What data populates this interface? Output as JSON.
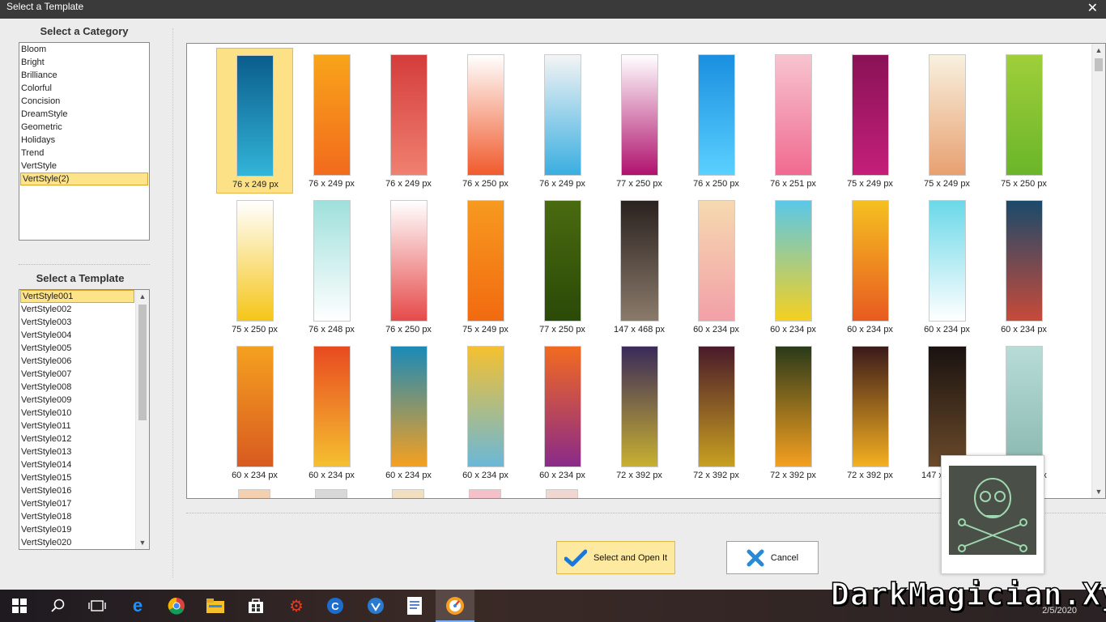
{
  "window": {
    "title": "Select a Template",
    "close_glyph": "✕"
  },
  "category_panel": {
    "heading": "Select a Category",
    "items": [
      "Bloom",
      "Bright",
      "Brilliance",
      "Colorful",
      "Concision",
      "DreamStyle",
      "Geometric",
      "Holidays",
      "Trend",
      "VertStyle",
      "VertStyle(2)"
    ],
    "selected": "VertStyle(2)"
  },
  "template_panel": {
    "heading": "Select a Template",
    "items": [
      "VertStyle001",
      "VertStyle002",
      "VertStyle003",
      "VertStyle004",
      "VertStyle005",
      "VertStyle006",
      "VertStyle007",
      "VertStyle008",
      "VertStyle009",
      "VertStyle010",
      "VertStyle011",
      "VertStyle012",
      "VertStyle013",
      "VertStyle014",
      "VertStyle015",
      "VertStyle016",
      "VertStyle017",
      "VertStyle018",
      "VertStyle019",
      "VertStyle020"
    ],
    "selected": "VertStyle001"
  },
  "gallery": {
    "rows": [
      [
        {
          "caption": "76 x 249 px",
          "c1": "#0a5d8c",
          "c2": "#33b4d8",
          "selected": true
        },
        {
          "caption": "76 x 249 px",
          "c1": "#f8a41a",
          "c2": "#f26b1d"
        },
        {
          "caption": "76 x 249 px",
          "c1": "#d43c3c",
          "c2": "#f08070"
        },
        {
          "caption": "76 x 250 px",
          "c1": "#ffffff",
          "c2": "#f05a2c"
        },
        {
          "caption": "76 x 249 px",
          "c1": "#f4f4f4",
          "c2": "#3aaee0"
        },
        {
          "caption": "77 x 250 px",
          "c1": "#ffffff",
          "c2": "#b0126e"
        },
        {
          "caption": "76 x 250 px",
          "c1": "#1a8fe0",
          "c2": "#5ad0ff"
        },
        {
          "caption": "76 x 251 px",
          "c1": "#f7c4d0",
          "c2": "#f06a90"
        },
        {
          "caption": "75 x 249 px",
          "c1": "#8a1256",
          "c2": "#c41f7a"
        },
        {
          "caption": "75 x 249 px",
          "c1": "#f8f1e0",
          "c2": "#e8a070"
        },
        {
          "caption": "75 x 250 px",
          "c1": "#9fcf3a",
          "c2": "#6bb52a"
        }
      ],
      [
        {
          "caption": "75 x 250 px",
          "c1": "#ffffff",
          "c2": "#f5c518"
        },
        {
          "caption": "76 x 248 px",
          "c1": "#9fe0dc",
          "c2": "#ffffff"
        },
        {
          "caption": "76 x 250 px",
          "c1": "#ffffff",
          "c2": "#e64a4a"
        },
        {
          "caption": "75 x 249 px",
          "c1": "#f79a20",
          "c2": "#f26a10"
        },
        {
          "caption": "77 x 250 px",
          "c1": "#4a6a10",
          "c2": "#2a4a08"
        },
        {
          "caption": "147 x 468 px",
          "c1": "#2a2220",
          "c2": "#8a7a6a"
        },
        {
          "caption": "60 x 234 px",
          "c1": "#f6d9b0",
          "c2": "#f2a0a8"
        },
        {
          "caption": "60 x 234 px",
          "c1": "#5ac8e8",
          "c2": "#f5d020"
        },
        {
          "caption": "60 x 234 px",
          "c1": "#f5c020",
          "c2": "#e85a20"
        },
        {
          "caption": "60 x 234 px",
          "c1": "#6ad8e8",
          "c2": "#ffffff"
        },
        {
          "caption": "60 x 234 px",
          "c1": "#1a4a6a",
          "c2": "#c84a3a"
        }
      ],
      [
        {
          "caption": "60 x 234 px",
          "c1": "#f5a020",
          "c2": "#d85a20"
        },
        {
          "caption": "60 x 234 px",
          "c1": "#e84a20",
          "c2": "#f5c030"
        },
        {
          "caption": "60 x 234 px",
          "c1": "#1a8ab8",
          "c2": "#f5a020"
        },
        {
          "caption": "60 x 234 px",
          "c1": "#f5c030",
          "c2": "#6ab8d8"
        },
        {
          "caption": "60 x 234 px",
          "c1": "#f26a20",
          "c2": "#8a2a8a"
        },
        {
          "caption": "72 x 392 px",
          "c1": "#3a2a5a",
          "c2": "#c8b030"
        },
        {
          "caption": "72 x 392 px",
          "c1": "#4a1a2a",
          "c2": "#c8a020"
        },
        {
          "caption": "72 x 392 px",
          "c1": "#2a3a1a",
          "c2": "#f5a020"
        },
        {
          "caption": "72 x 392 px",
          "c1": "#3a1a1a",
          "c2": "#f5b020"
        },
        {
          "caption": "147 x 468 px",
          "c1": "#1a1210",
          "c2": "#6a4a2a"
        },
        {
          "caption": "60 x 234 px",
          "c1": "#b8dcd8",
          "c2": "#8ab8b0"
        }
      ]
    ]
  },
  "buttons": {
    "select_open": "Select and Open It",
    "cancel": "Cancel"
  },
  "watermark": "DarkMagician.Xyz",
  "clock": "2/5/2020"
}
